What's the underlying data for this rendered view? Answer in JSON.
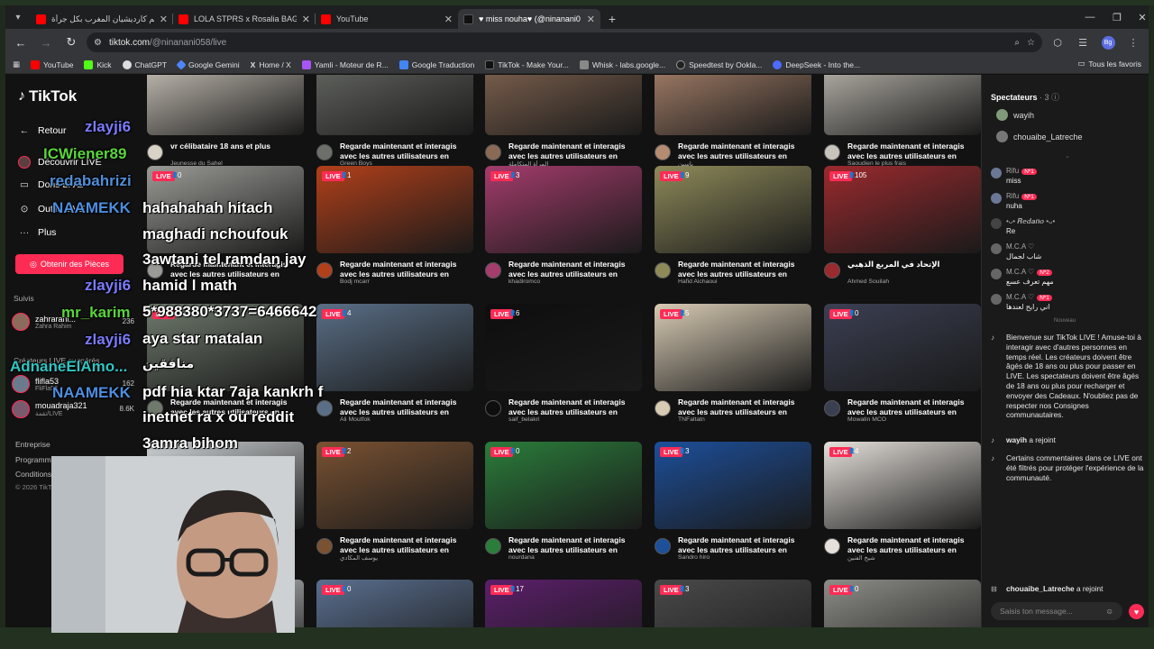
{
  "browser": {
    "tabs": [
      {
        "title": "كيم كارديشيان المغرب بكل جرأة...",
        "active": false,
        "icon_color": "#ff0000"
      },
      {
        "title": "LOLA STPRS x Rosalia BAGDAD",
        "active": false,
        "icon_color": "#ff0000"
      },
      {
        "title": "YouTube",
        "active": false,
        "icon_color": "#ff0000"
      },
      {
        "title": "♥ miss nouha♥ (@ninanani0",
        "active": true,
        "icon_color": "#111111"
      }
    ],
    "url_host": "tiktok.com",
    "url_path": "/@ninanani058/live",
    "profile_initials": "Bg",
    "bookmarks": [
      {
        "label": "YouTube",
        "color": "#ff0000"
      },
      {
        "label": "Kick",
        "color": "#53fc18"
      },
      {
        "label": "ChatGPT",
        "color": "#ffffff"
      },
      {
        "label": "Google Gemini",
        "color": "#4e86f8"
      },
      {
        "label": "Home / X",
        "color": "#ffffff"
      },
      {
        "label": "Yamli - Moteur de R...",
        "color": "#a855f7"
      },
      {
        "label": "Google Traduction",
        "color": "#4285f4"
      },
      {
        "label": "TikTok - Make Your...",
        "color": "#111111"
      },
      {
        "label": "Whisk - labs.google...",
        "color": "#888888"
      },
      {
        "label": "Speedtest by Ookla...",
        "color": "#222222"
      },
      {
        "label": "DeepSeek - Into the...",
        "color": "#4d6bfe"
      }
    ],
    "all_bookmarks": "Tous les favoris"
  },
  "sidebar": {
    "logo": "TikTok",
    "back": "Retour",
    "nav": [
      "Découvrir LIVE",
      "Dons LIVE",
      "Outils LIVE",
      "Plus"
    ],
    "coins_button": "Obtenir des Pièces",
    "followed_header": "Suivis",
    "followed": [
      {
        "name": "zahrarahi...",
        "sub": "Zahra Rahim",
        "count": "236"
      }
    ],
    "suggested_header": "Créateurs LIVE suggérés",
    "suggested": [
      {
        "name": "flifla53",
        "sub": "FliFla53",
        "count": "162"
      },
      {
        "name": "mouadraja321",
        "sub": "تقمة/LIVE",
        "count": "8.6K"
      }
    ],
    "footer": [
      "Entreprise",
      "Programme",
      "Conditions",
      "© 2026 TikTok"
    ]
  },
  "grid": {
    "live_label": "LIVE",
    "rows": [
      [
        {
          "viewers": "",
          "title": "vr célibataire 18 ans et plus",
          "user": "Jeunesse du Sahel",
          "thumb": "#d9d2c7"
        },
        {
          "viewers": "",
          "title": "Regarde maintenant et interagis avec les autres utilisateurs en temp...",
          "user": "Green Boys",
          "thumb": "#6d6f6a"
        },
        {
          "viewers": "",
          "title": "Regarde maintenant et interagis avec les autres utilisateurs en temp...",
          "user": "المرأة المتكاملة",
          "thumb": "#8a6a55"
        },
        {
          "viewers": "",
          "title": "Regarde maintenant et interagis avec les autres utilisateurs en temp...",
          "user": "ياسين",
          "thumb": "#b58b72"
        },
        {
          "viewers": "",
          "title": "Regarde maintenant et interagis avec les autres utilisateurs en temp...",
          "user": "Saoudien le plus frais",
          "thumb": "#c9c4bb"
        }
      ],
      [
        {
          "viewers": "0",
          "title": "Regarde maintenant et interagis avec les autres utilisateurs en temp...",
          "user": "",
          "thumb": "#9a9a96"
        },
        {
          "viewers": "1",
          "title": "Regarde maintenant et interagis avec les autres utilisateurs en temp...",
          "user": "Bodj mcarr",
          "thumb": "#b2401a"
        },
        {
          "viewers": "3",
          "title": "Regarde maintenant et interagis avec les autres utilisateurs en temp...",
          "user": "khadiromco",
          "thumb": "#a43c6c"
        },
        {
          "viewers": "9",
          "title": "Regarde maintenant et interagis avec les autres utilisateurs en temp...",
          "user": "Hafid Aichaoui",
          "thumb": "#8e8a5a"
        },
        {
          "viewers": "105",
          "title": "الإتحاد في المربع الذهبي",
          "user": "Ahmed Souilah",
          "thumb": "#9b2a2e"
        }
      ],
      [
        {
          "viewers": "",
          "title": "Regarde maintenant et interagis avec les autres utilisateurs en temp...",
          "user": "",
          "thumb": "#6f7a6d"
        },
        {
          "viewers": "4",
          "title": "Regarde maintenant et interagis avec les autres utilisateurs en temp...",
          "user": "Ali Moutfok",
          "thumb": "#5a6f87"
        },
        {
          "viewers": "6",
          "title": "Regarde maintenant et interagis avec les autres utilisateurs en temp...",
          "user": "saif_belakri",
          "thumb": "#0e0e0f"
        },
        {
          "viewers": "5",
          "title": "Regarde maintenant et interagis avec les autres utilisateurs en temp...",
          "user": "TNFaltatn",
          "thumb": "#d8cbb4"
        },
        {
          "viewers": "0",
          "title": "Regarde maintenant et interagis avec les autres utilisateurs en temp...",
          "user": "Mowatin MCO",
          "thumb": "#3b3f52"
        }
      ],
      [
        {
          "viewers": "",
          "title": "",
          "user": "",
          "thumb": "#cfd3d6"
        },
        {
          "viewers": "2",
          "title": "Regarde maintenant et interagis avec les autres utilisateurs en temp...",
          "user": "يوسف المكادي",
          "thumb": "#7a5232"
        },
        {
          "viewers": "0",
          "title": "Regarde maintenant et interagis avec les autres utilisateurs en temp...",
          "user": "nourdana",
          "thumb": "#2b7d3b"
        },
        {
          "viewers": "3",
          "title": "Regarde maintenant et interagis avec les autres utilisateurs en temp...",
          "user": "Sandro hiro",
          "thumb": "#1d4f9a"
        },
        {
          "viewers": "4",
          "title": "Regarde maintenant et interagis avec les autres utilisateurs en temp...",
          "user": "شيخ الفنين",
          "thumb": "#e5e0da"
        }
      ],
      [
        {
          "viewers": "",
          "title": "",
          "user": "",
          "thumb": "#cfd3d6"
        },
        {
          "viewers": "0",
          "title": "",
          "user": "",
          "thumb": "#5a6f8f"
        },
        {
          "viewers": "17",
          "title": "",
          "user": "",
          "thumb": "#5b1f6a"
        },
        {
          "viewers": "3",
          "title": "",
          "user": "",
          "thumb": "#4a4a4a"
        },
        {
          "viewers": "0",
          "title": "",
          "user": "",
          "thumb": "#8d8d88"
        }
      ]
    ]
  },
  "right_panel": {
    "spectators_label": "Spectateurs",
    "spectators_count": "· 3",
    "spectators": [
      "wayih",
      "chouaibe_Latreche"
    ],
    "chat": [
      {
        "name": "Rifu",
        "badge": "Nº1",
        "msg": "miss"
      },
      {
        "name": "Rifu",
        "badge": "Nº1",
        "msg": "nuha"
      },
      {
        "name": "•ᴗ• 𝑹𝒆𝒅𝒂𝒏𝒐 •ᴗ•",
        "badge": "",
        "msg": "Re"
      },
      {
        "name": "M.C.A ♡",
        "badge": "",
        "msg": "شاب لجمال"
      },
      {
        "name": "M.C.A ♡",
        "badge": "Nº2",
        "msg": "مهم تعرف عسع"
      },
      {
        "name": "M.C.A ♡",
        "badge": "Nº1",
        "msg": "اني رايح لعندها"
      }
    ],
    "divider": "Nouveau",
    "system_welcome": "Bienvenue sur TikTok LIVE ! Amuse-toi à interagir avec d'autres personnes en temps réel. Les créateurs doivent être âgés de 18 ans ou plus pour passer en LIVE. Les spectateurs doivent être âgés de 18 ans ou plus pour recharger et envoyer des Cadeaux. N'oubliez pas de respecter nos Consignes communautaires.",
    "join1_user": "wayih",
    "join1_text": "a rejoint",
    "filter_note": "Certains commentaires dans ce LIVE ont été filtrés pour protéger l'expérience de la communauté.",
    "join2_user": "chouaibe_Latreche",
    "join2_text": "a rejoint",
    "input_placeholder": "Saisis ton message..."
  },
  "overlay": {
    "names": [
      {
        "text": "zlayji6",
        "color": "#7b7bff"
      },
      {
        "text": "ICWiener89",
        "color": "#59d63a"
      },
      {
        "text": "redabahrizi",
        "color": "#4f8fd9"
      },
      {
        "text": "NAAMEKK",
        "color": "#4d8ee0"
      },
      {
        "text": "zlayji6",
        "color": "#7b7bff"
      },
      {
        "text": "mr_karim",
        "color": "#59d63a"
      },
      {
        "text": "zlayji6",
        "color": "#7b7bff"
      },
      {
        "text": "AdnaneElAmo...",
        "color": "#2fc6c3"
      },
      {
        "text": "NAAMEKK",
        "color": "#4d8ee0"
      }
    ],
    "messages": [
      "hahahahah hitach",
      "maghadi nchoufouk",
      "3awtani tel ramdan jay",
      "hamid l math",
      "5*988380*3737=6466642",
      "aya star matalan",
      "منافقين",
      "pdf hia ktar 7aja kankrh f",
      "inetnet ra x ou reddit",
      "3amra bihom"
    ]
  }
}
